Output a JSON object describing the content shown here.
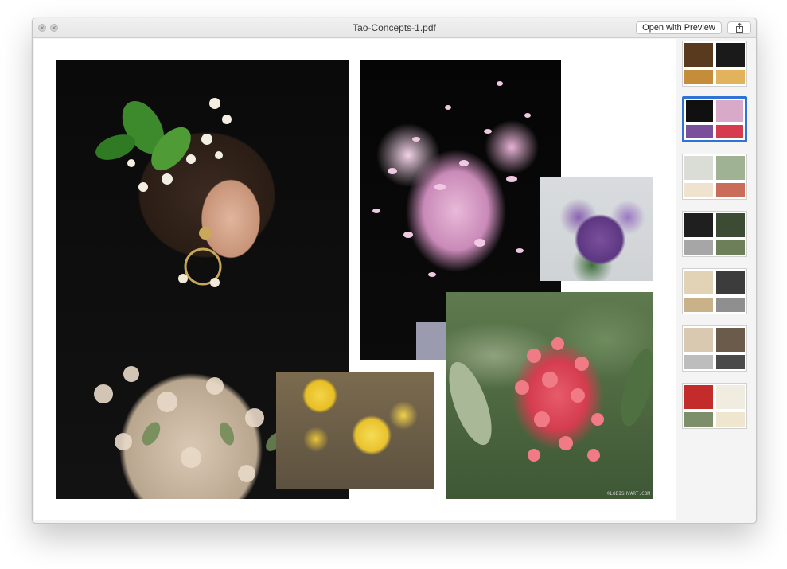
{
  "window": {
    "title": "Tao-Concepts-1.pdf",
    "open_with_preview_label": "Open with Preview"
  },
  "icons": {
    "close": "close-icon",
    "minimize": "minimize-icon",
    "share": "share-icon"
  },
  "document": {
    "photos": [
      {
        "name": "woman-with-floral-headpiece"
      },
      {
        "name": "pink-petals-burst"
      },
      {
        "name": "purple-flowers"
      },
      {
        "name": "red-ixora-flowers",
        "watermark": "©LOBISHVART.COM"
      },
      {
        "name": "yellow-jasmine-flowers"
      }
    ]
  },
  "sidebar": {
    "thumbnails": [
      {
        "page": 1,
        "selected": false,
        "palette": [
          "#5a3a1e",
          "#1a1a1a",
          "#c58c3a",
          "#e2b35c"
        ]
      },
      {
        "page": 2,
        "selected": true,
        "palette": [
          "#101010",
          "#d9a9c9",
          "#7a4f9c",
          "#d53d4f"
        ]
      },
      {
        "page": 3,
        "selected": false,
        "palette": [
          "#d9ddd6",
          "#9fb394",
          "#efe3cf",
          "#c96c5a"
        ]
      },
      {
        "page": 4,
        "selected": false,
        "palette": [
          "#1f1f1f",
          "#3c4b34",
          "#a6a6a6",
          "#6c7f58"
        ]
      },
      {
        "page": 5,
        "selected": false,
        "palette": [
          "#e2d2b6",
          "#3c3c3c",
          "#c9b28a",
          "#8f8f8f"
        ]
      },
      {
        "page": 6,
        "selected": false,
        "palette": [
          "#d8c9b0",
          "#6b5b4a",
          "#bdbdbd",
          "#4a4a4a"
        ]
      },
      {
        "page": 7,
        "selected": false,
        "palette": [
          "#c42b2b",
          "#f1ece0",
          "#7c8f6a",
          "#efe6cf"
        ]
      }
    ]
  }
}
